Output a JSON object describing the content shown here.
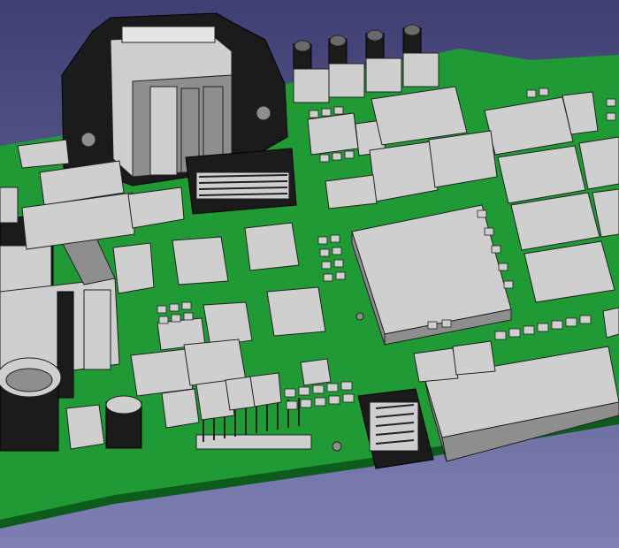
{
  "scene": {
    "subject": "pcb-3d-render",
    "colors": {
      "background_top": "#3f3f74",
      "background_bottom": "#7e80b4",
      "pcb_green": "#1f9a35",
      "pcb_edge": "#0d5c1e",
      "component_grey": "#cfcfcf",
      "component_shade": "#8e8e8e",
      "component_dark": "#6a6a6a",
      "connector_black": "#1b1b1b",
      "outline": "#222222"
    }
  }
}
